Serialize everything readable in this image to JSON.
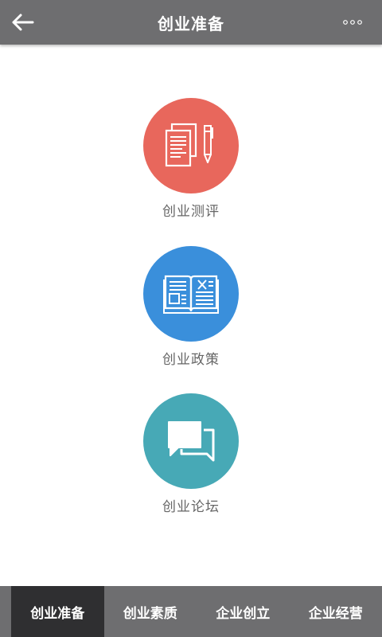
{
  "header": {
    "title": "创业准备",
    "back_icon": "arrow-left-icon",
    "more_icon": "more-dots-icon"
  },
  "menu": [
    {
      "label": "创业测评",
      "icon": "document-pen-icon",
      "color": "#e8675c"
    },
    {
      "label": "创业政策",
      "icon": "open-book-icon",
      "color": "#3a8fdb"
    },
    {
      "label": "创业论坛",
      "icon": "chat-bubbles-icon",
      "color": "#47a9b6"
    }
  ],
  "tabs": [
    {
      "label": "创业准备",
      "active": true
    },
    {
      "label": "创业素质",
      "active": false
    },
    {
      "label": "企业创立",
      "active": false
    },
    {
      "label": "企业经营",
      "active": false
    }
  ],
  "colors": {
    "bar": "#6e6e70",
    "active_tab": "#2f2f31",
    "label_text": "#666666"
  }
}
